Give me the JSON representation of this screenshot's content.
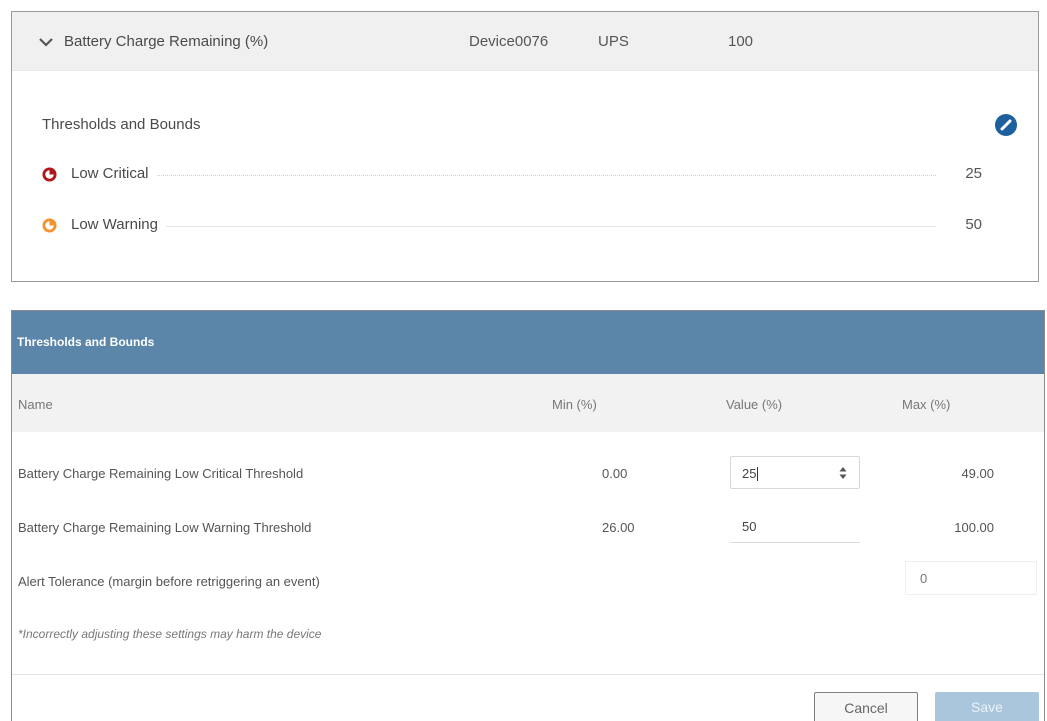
{
  "summary": {
    "title": "Battery Charge Remaining (%)",
    "device": "Device0076",
    "type": "UPS",
    "value": "100"
  },
  "thresholds_panel": {
    "title": "Thresholds and Bounds",
    "rows": [
      {
        "label": "Low Critical",
        "value": "25",
        "color": "#b0161b"
      },
      {
        "label": "Low Warning",
        "value": "50",
        "color": "#f5922f"
      }
    ]
  },
  "dialog": {
    "header": "Thresholds and Bounds",
    "columns": {
      "name": "Name",
      "min": "Min (%)",
      "value": "Value (%)",
      "max": "Max (%)"
    },
    "rows": [
      {
        "name": "Battery Charge Remaining Low Critical Threshold",
        "min": "0.00",
        "value": "25",
        "max": "49.00"
      },
      {
        "name": "Battery Charge Remaining Low Warning Threshold",
        "min": "26.00",
        "value": "50",
        "max": "100.00"
      }
    ],
    "tolerance": {
      "label": "Alert Tolerance (margin before retriggering an event)",
      "value": "0"
    },
    "note": "*Incorrectly adjusting these settings may harm the device",
    "cancel_label": "Cancel",
    "save_label": "Save"
  },
  "colors": {
    "header_blue": "#5b86aa",
    "edit_blue": "#1e5f9e",
    "save_disabled": "#a9c6dc"
  }
}
